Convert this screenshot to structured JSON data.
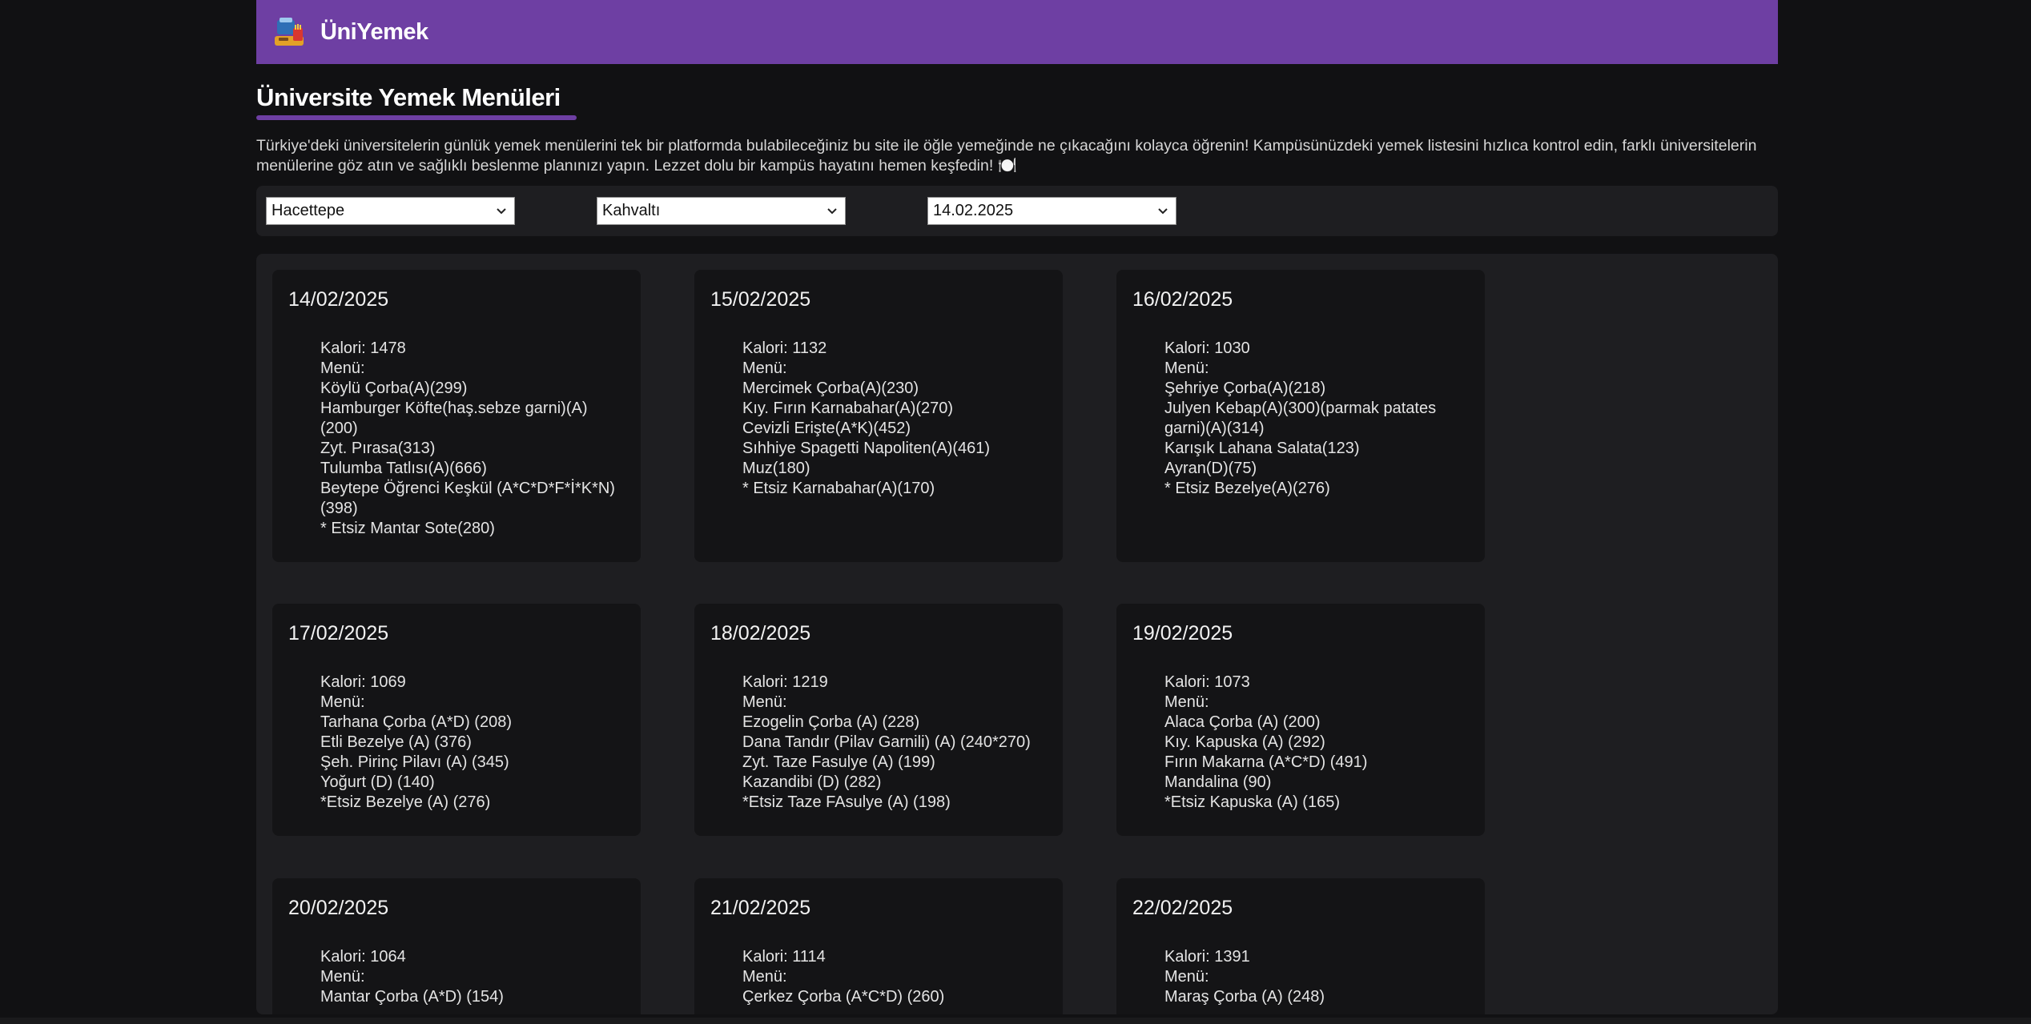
{
  "header": {
    "brand": "ÜniYemek",
    "logo_icon": "food-tray-icon"
  },
  "page": {
    "title": "Üniversite Yemek Menüleri",
    "description": "Türkiye'deki üniversitelerin günlük yemek menülerini tek bir platformda bulabileceğiniz bu site ile öğle yemeğinde ne çıkacağını kolayca öğrenin! Kampüsünüzdeki yemek listesini hızlıca kontrol edin, farklı üniversitelerin menülerine göz atın ve sağlıklı beslenme planınızı yapın. Lezzet dolu bir kampüs hayatını hemen keşfedin! 🍽️"
  },
  "filters": {
    "university": "Hacettepe",
    "meal": "Kahvaltı",
    "date": "14.02.2025"
  },
  "cards": [
    {
      "date": "14/02/2025",
      "calories": "Kalori: 1478",
      "menu_label": "Menü:",
      "items": [
        "Köylü Çorba(A)(299)",
        "Hamburger Köfte(haş.sebze garni)(A)(200)",
        "Zyt. Pırasa(313)",
        "Tulumba Tatlısı(A)(666)",
        "Beytepe Öğrenci Keşkül (A*C*D*F*İ*K*N) (398)",
        "* Etsiz Mantar Sote(280)"
      ]
    },
    {
      "date": "15/02/2025",
      "calories": "Kalori: 1132",
      "menu_label": "Menü:",
      "items": [
        "Mercimek Çorba(A)(230)",
        "Kıy. Fırın Karnabahar(A)(270)",
        "Cevizli Erişte(A*K)(452)",
        "Sıhhiye Spagetti Napoliten(A)(461)",
        "Muz(180)",
        "* Etsiz Karnabahar(A)(170)"
      ]
    },
    {
      "date": "16/02/2025",
      "calories": "Kalori: 1030",
      "menu_label": "Menü:",
      "items": [
        "Şehriye Çorba(A)(218)",
        "Julyen Kebap(A)(300)(parmak patates garni)(A)(314)",
        "Karışık Lahana Salata(123)",
        "Ayran(D)(75)",
        "* Etsiz Bezelye(A)(276)"
      ]
    },
    {
      "date": "17/02/2025",
      "calories": "Kalori: 1069",
      "menu_label": "Menü:",
      "items": [
        "Tarhana Çorba (A*D) (208)",
        "Etli Bezelye (A) (376)",
        "Şeh. Pirinç Pilavı (A) (345)",
        "Yoğurt (D) (140)",
        "*Etsiz Bezelye (A) (276)"
      ]
    },
    {
      "date": "18/02/2025",
      "calories": "Kalori: 1219",
      "menu_label": "Menü:",
      "items": [
        "Ezogelin Çorba (A) (228)",
        "Dana Tandır (Pilav Garnili) (A) (240*270)",
        "Zyt. Taze Fasulye (A) (199)",
        "Kazandibi (D) (282)",
        "*Etsiz Taze FAsulye (A) (198)"
      ]
    },
    {
      "date": "19/02/2025",
      "calories": "Kalori: 1073",
      "menu_label": "Menü:",
      "items": [
        "Alaca Çorba (A) (200)",
        "Kıy. Kapuska (A) (292)",
        "Fırın Makarna (A*C*D) (491)",
        "Mandalina (90)",
        "*Etsiz Kapuska (A) (165)"
      ]
    },
    {
      "date": "20/02/2025",
      "calories": "Kalori: 1064",
      "menu_label": "Menü:",
      "items": [
        "Mantar Çorba (A*D) (154)"
      ]
    },
    {
      "date": "21/02/2025",
      "calories": "Kalori: 1114",
      "menu_label": "Menü:",
      "items": [
        "Çerkez Çorba (A*C*D) (260)"
      ]
    },
    {
      "date": "22/02/2025",
      "calories": "Kalori: 1391",
      "menu_label": "Menü:",
      "items": [
        "Maraş Çorba (A) (248)"
      ]
    }
  ]
}
